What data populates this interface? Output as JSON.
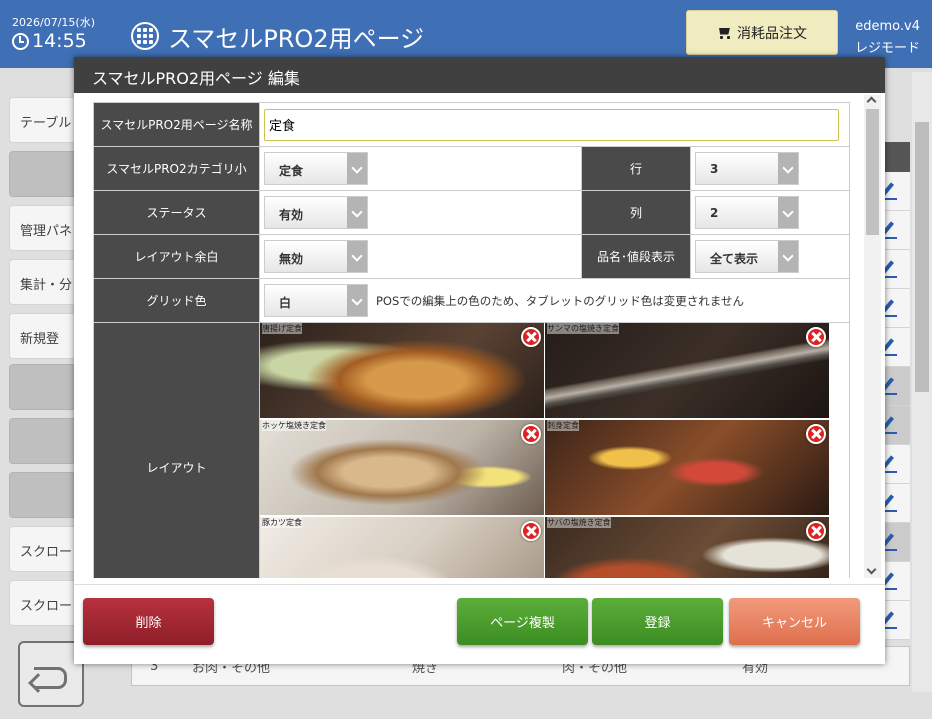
{
  "header": {
    "date": "2026/07/15(水)",
    "time": "14:55",
    "title": "スマセルPRO2用ページ",
    "order_button": "消耗品注文",
    "user_name": "edemo.v4",
    "mode": "レジモード"
  },
  "sidebar": {
    "items": [
      {
        "label": "テーブル"
      },
      {
        "label": ""
      },
      {
        "label": "管理パネ"
      },
      {
        "label": "集計・分"
      },
      {
        "label": "新規登"
      },
      {
        "label": ""
      },
      {
        "label": ""
      },
      {
        "label": ""
      },
      {
        "label": "スクロー"
      },
      {
        "label": "スクロー"
      }
    ]
  },
  "background_table": {
    "last_row": [
      "3",
      "お肉・その他",
      "焼き",
      "肉・その他",
      "有効"
    ]
  },
  "modal": {
    "title": "スマセルPRO2用ページ 編集",
    "fields": {
      "page_name_label": "スマセルPRO2用ページ名称",
      "page_name_value": "定食",
      "category_label": "スマセルPRO2カテゴリ小",
      "category_value": "定食",
      "row_label": "行",
      "row_value": "3",
      "status_label": "ステータス",
      "status_value": "有効",
      "col_label": "列",
      "col_value": "2",
      "margin_label": "レイアウト余白",
      "margin_value": "無効",
      "display_label": "品名･値段表示",
      "display_value": "全て表示",
      "grid_color_label": "グリッド色",
      "grid_color_value": "白",
      "grid_color_note": "POSでの編集上の色のため、タブレットのグリッド色は変更されません",
      "layout_label": "レイアウト"
    },
    "tiles": [
      {
        "caption": "唐揚げ定食"
      },
      {
        "caption": "サンマの塩焼き定食"
      },
      {
        "caption": "ホッケ塩焼き定食"
      },
      {
        "caption": "刺身定食"
      },
      {
        "caption": "豚カツ定食"
      },
      {
        "caption": "サバの塩焼き定食"
      }
    ],
    "buttons": {
      "delete": "削除",
      "duplicate": "ページ複製",
      "register": "登録",
      "cancel": "キャンセル"
    }
  }
}
